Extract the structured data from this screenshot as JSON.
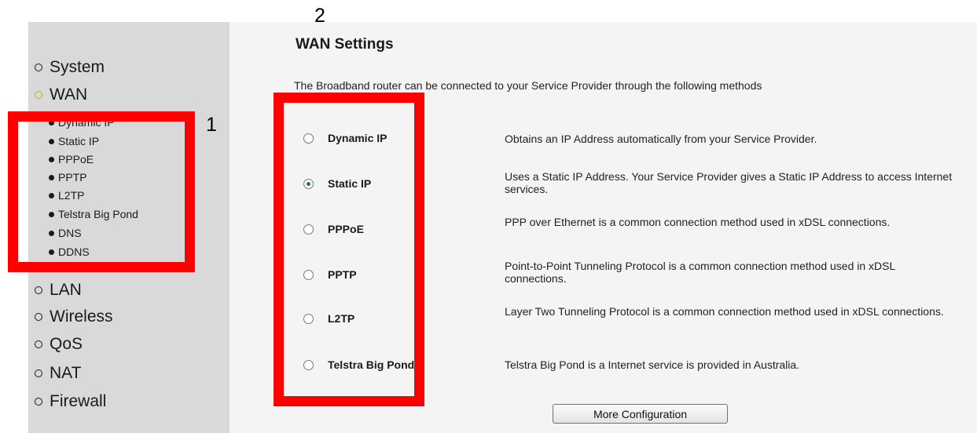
{
  "sidebar": {
    "items": [
      {
        "label": "System"
      },
      {
        "label": "WAN"
      },
      {
        "label": "LAN"
      },
      {
        "label": "Wireless"
      },
      {
        "label": "QoS"
      },
      {
        "label": "NAT"
      },
      {
        "label": "Firewall"
      }
    ],
    "wan_subitems": [
      {
        "label": "Dynamic IP"
      },
      {
        "label": "Static IP"
      },
      {
        "label": "PPPoE"
      },
      {
        "label": "PPTP"
      },
      {
        "label": "L2TP"
      },
      {
        "label": "Telstra Big Pond"
      },
      {
        "label": "DNS"
      },
      {
        "label": "DDNS"
      }
    ]
  },
  "main": {
    "title": "WAN Settings",
    "intro": "The Broadband router can be connected to your Service Provider through the following methods",
    "options": [
      {
        "label": "Dynamic IP",
        "description": "Obtains an IP Address automatically from your Service Provider.",
        "selected": false
      },
      {
        "label": "Static IP",
        "description": "Uses a Static IP Address. Your Service Provider gives a Static IP Address to access Internet services.",
        "selected": true
      },
      {
        "label": "PPPoE",
        "description": "PPP over Ethernet is a common connection method used in xDSL connections.",
        "selected": false
      },
      {
        "label": "PPTP",
        "description": "Point-to-Point Tunneling Protocol is a common connection method used in xDSL connections.",
        "selected": false
      },
      {
        "label": "L2TP",
        "description": "Layer Two Tunneling Protocol is a common connection method used in xDSL connections.",
        "selected": false
      },
      {
        "label": "Telstra Big Pond",
        "description": "Telstra Big Pond is a Internet service is provided in Australia.",
        "selected": false
      }
    ],
    "more_button": "More Configuration"
  },
  "annotations": {
    "label_1": "1",
    "label_2": "2",
    "highlight_color": "#ff0000"
  }
}
